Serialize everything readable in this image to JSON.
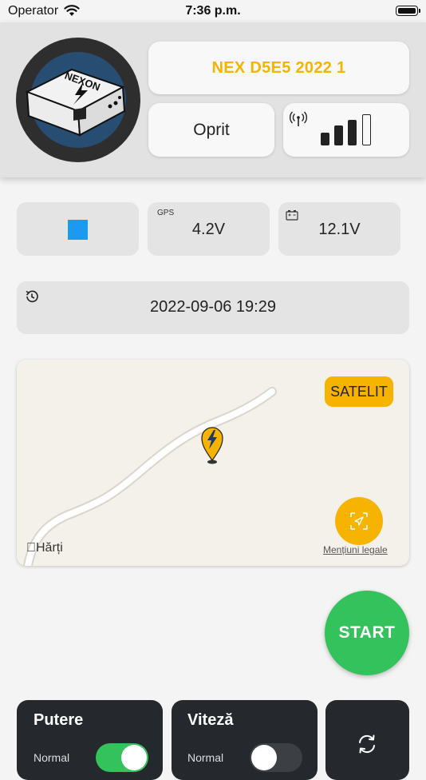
{
  "status_bar": {
    "carrier": "Operator",
    "time": "7:36 p.m."
  },
  "device": {
    "name": "NEX D5E5 2022 1",
    "state": "Oprit",
    "logo_text": "NEXON",
    "signal_level_bars": 3,
    "signal_total_bars": 4
  },
  "info": {
    "color_hex": "#1a9bf0",
    "gps_label": "GPS",
    "gps_value": "4.2V",
    "battery_value": "12.1V",
    "last_update": "2022-09-06 19:29"
  },
  "map": {
    "satellite_button": "SATELIT",
    "maps_logo": "Hărți",
    "legal_link": "Mențiuni legale",
    "pin_icon": "lightning-pin-icon",
    "accent_color": "#f6b400"
  },
  "controls": {
    "start_label": "START",
    "start_color": "#33c25c",
    "putere": {
      "title": "Putere",
      "subtitle": "Normal",
      "enabled": true
    },
    "viteza": {
      "title": "Viteză",
      "subtitle": "Normal",
      "enabled": false
    }
  }
}
